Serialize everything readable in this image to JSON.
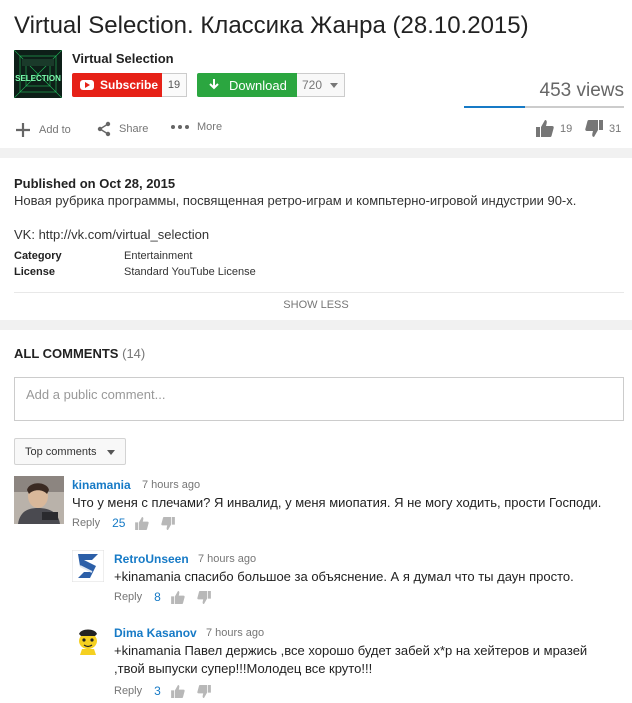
{
  "video": {
    "title": "Virtual Selection. Классика Жанра (28.10.2015)",
    "channel": "Virtual Selection",
    "thumb_text": "SELECTION",
    "subscribe_label": "Subscribe",
    "subscriber_count": "19",
    "download_label": "Download",
    "download_count": "720",
    "views": "453 views",
    "like_ratio": 0.38,
    "actions": {
      "add_to": "Add to",
      "share": "Share",
      "more": "More"
    },
    "likes": "19",
    "dislikes": "31"
  },
  "description": {
    "published": "Published on Oct 28, 2015",
    "text": "Новая рубрика программы, посвященная ретро-играм и компьтерно-игровой индустрии 90-х.",
    "vk": "VK: http://vk.com/virtual_selection",
    "category_label": "Category",
    "category_value": "Entertainment",
    "license_label": "License",
    "license_value": "Standard YouTube License",
    "show_less": "SHOW LESS"
  },
  "comments_section": {
    "heading": "ALL COMMENTS",
    "count": "(14)",
    "placeholder": "Add a public comment...",
    "sort_label": "Top comments",
    "reply_label": "Reply",
    "items": [
      {
        "author": "kinamania",
        "time": "7 hours ago",
        "text": "Что у меня с плечами? Я инвалид, у меня миопатия. Я не могу ходить, прости Господи.",
        "likes": "25"
      },
      {
        "author": "RetroUnseen",
        "time": "7 hours ago",
        "text": "+kinamania спасибо большое за объяснение. А я думал что ты даун просто.",
        "likes": "8"
      },
      {
        "author": "Dima Kasanov",
        "time": "7 hours ago",
        "text": "+kinamania Павел держись ,все хорошо будет забей х*р на хейтеров и мразей ,твой выпуски супер!!!Молодец все круто!!!",
        "likes": "3"
      }
    ]
  },
  "colors": {
    "subscribe": "#e62117",
    "download": "#2ba640",
    "link": "#167ac6",
    "sentiment": "#167ac6"
  }
}
